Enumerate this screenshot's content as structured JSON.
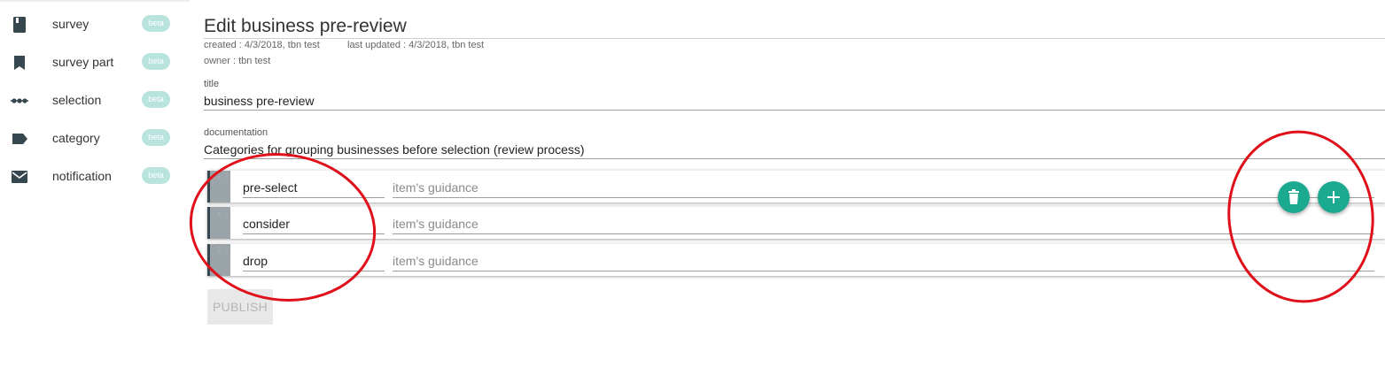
{
  "sidebar": {
    "items": [
      {
        "label": "survey",
        "badge": "beta",
        "icon": "book-icon"
      },
      {
        "label": "survey part",
        "badge": "beta",
        "icon": "bookmark-icon"
      },
      {
        "label": "selection",
        "badge": "beta",
        "icon": "dots-icon"
      },
      {
        "label": "category",
        "badge": "beta",
        "icon": "label-icon"
      },
      {
        "label": "notification",
        "badge": "beta",
        "icon": "mail-icon"
      }
    ]
  },
  "page": {
    "title": "Edit business pre-review",
    "created": "created : 4/3/2018, tbn test",
    "last_updated": "last updated : 4/3/2018, tbn test",
    "owner": "owner : tbn test"
  },
  "form": {
    "title_label": "title",
    "title_value": "business pre-review",
    "documentation_label": "documentation",
    "documentation_value": "Categories for grouping businesses before selection (review process)"
  },
  "items": [
    {
      "name": "pre-select",
      "guidance_placeholder": "item's guidance"
    },
    {
      "name": "consider",
      "guidance_placeholder": "item's guidance"
    },
    {
      "name": "drop",
      "guidance_placeholder": "item's guidance"
    }
  ],
  "actions": {
    "delete_icon": "trash-icon",
    "add_icon": "plus-icon",
    "publish_label": "PUBLISH"
  },
  "colors": {
    "accent": "#1ba98f",
    "badge": "#b9e4de",
    "annotation": "#e0101b"
  }
}
